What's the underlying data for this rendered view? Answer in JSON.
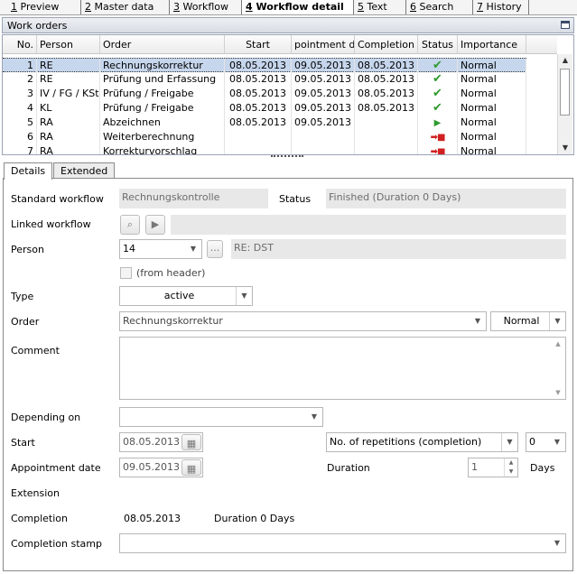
{
  "tabs": [
    {
      "key": "1",
      "label": "Preview"
    },
    {
      "key": "2",
      "label": "Master data"
    },
    {
      "key": "3",
      "label": "Workflow"
    },
    {
      "key": "4",
      "label": "Workflow detail"
    },
    {
      "key": "5",
      "label": "Text"
    },
    {
      "key": "6",
      "label": "Search"
    },
    {
      "key": "7",
      "label": "History"
    }
  ],
  "work_orders": {
    "title": "Work orders",
    "columns": [
      "No.",
      "Person",
      "Order",
      "Start",
      "pointment da",
      "Completion",
      "Status",
      "Importance"
    ],
    "rows": [
      {
        "no": "1",
        "person": "RE",
        "order": "Rechnungskorrektur",
        "start": "08.05.2013",
        "appointment": "09.05.2013",
        "completion": "08.05.2013",
        "status": "check-icon",
        "status_glyph": "✔",
        "importance": "Normal"
      },
      {
        "no": "2",
        "person": "RE",
        "order": "Prüfung und Erfassung",
        "start": "08.05.2013",
        "appointment": "09.05.2013",
        "completion": "08.05.2013",
        "status": "check-icon",
        "status_glyph": "✔",
        "importance": "Normal"
      },
      {
        "no": "3",
        "person": "IV / FG / KSt",
        "order": "Prüfung / Freigabe",
        "start": "08.05.2013",
        "appointment": "09.05.2013",
        "completion": "08.05.2013",
        "status": "check-icon",
        "status_glyph": "✔",
        "importance": "Normal"
      },
      {
        "no": "4",
        "person": "KL",
        "order": "Prüfung / Freigabe",
        "start": "08.05.2013",
        "appointment": "09.05.2013",
        "completion": "08.05.2013",
        "status": "check-icon",
        "status_glyph": "✔",
        "importance": "Normal"
      },
      {
        "no": "5",
        "person": "RA",
        "order": "Abzeichnen",
        "start": "08.05.2013",
        "appointment": "09.05.2013",
        "completion": "",
        "status": "play-icon",
        "status_glyph": "▶",
        "importance": "Normal"
      },
      {
        "no": "6",
        "person": "RA",
        "order": "Weiterberechnung",
        "start": "",
        "appointment": "",
        "completion": "",
        "status": "pending-arrow-icon",
        "status_glyph": "➡■",
        "importance": "Normal"
      },
      {
        "no": "7",
        "person": "RA",
        "order": "Korrekturvorschlag",
        "start": "",
        "appointment": "",
        "completion": "",
        "status": "pending-arrow-icon",
        "status_glyph": "➡■",
        "importance": "Normal"
      }
    ]
  },
  "detail_tabs": [
    "Details",
    "Extended"
  ],
  "detail": {
    "standard_workflow_label": "Standard workflow",
    "standard_workflow_value": "Rechnungskontrolle",
    "status_label": "Status",
    "status_value": "Finished (Duration 0 Days)",
    "linked_workflow_label": "Linked workflow",
    "person_label": "Person",
    "person_value": "14",
    "person_ellipsis": "...",
    "person_name": "RE: DST",
    "from_header_label": "(from header)",
    "type_label": "Type",
    "type_value": "active",
    "order_label": "Order",
    "order_value": "Rechnungskorrektur",
    "importance_value": "Normal",
    "comment_label": "Comment",
    "depending_on_label": "Depending on",
    "start_label": "Start",
    "start_value": "08.05.2013",
    "repetitions_value": "No. of repetitions (completion)",
    "repetitions_count": "0",
    "appointment_date_label": "Appointment date",
    "appointment_date_value": "09.05.2013",
    "duration_label": "Duration",
    "duration_value": "1",
    "days_label": "Days",
    "extension_label": "Extension",
    "completion_label": "Completion",
    "completion_value": "08.05.2013",
    "completion_duration": "Duration 0 Days",
    "completion_stamp_label": "Completion stamp"
  }
}
